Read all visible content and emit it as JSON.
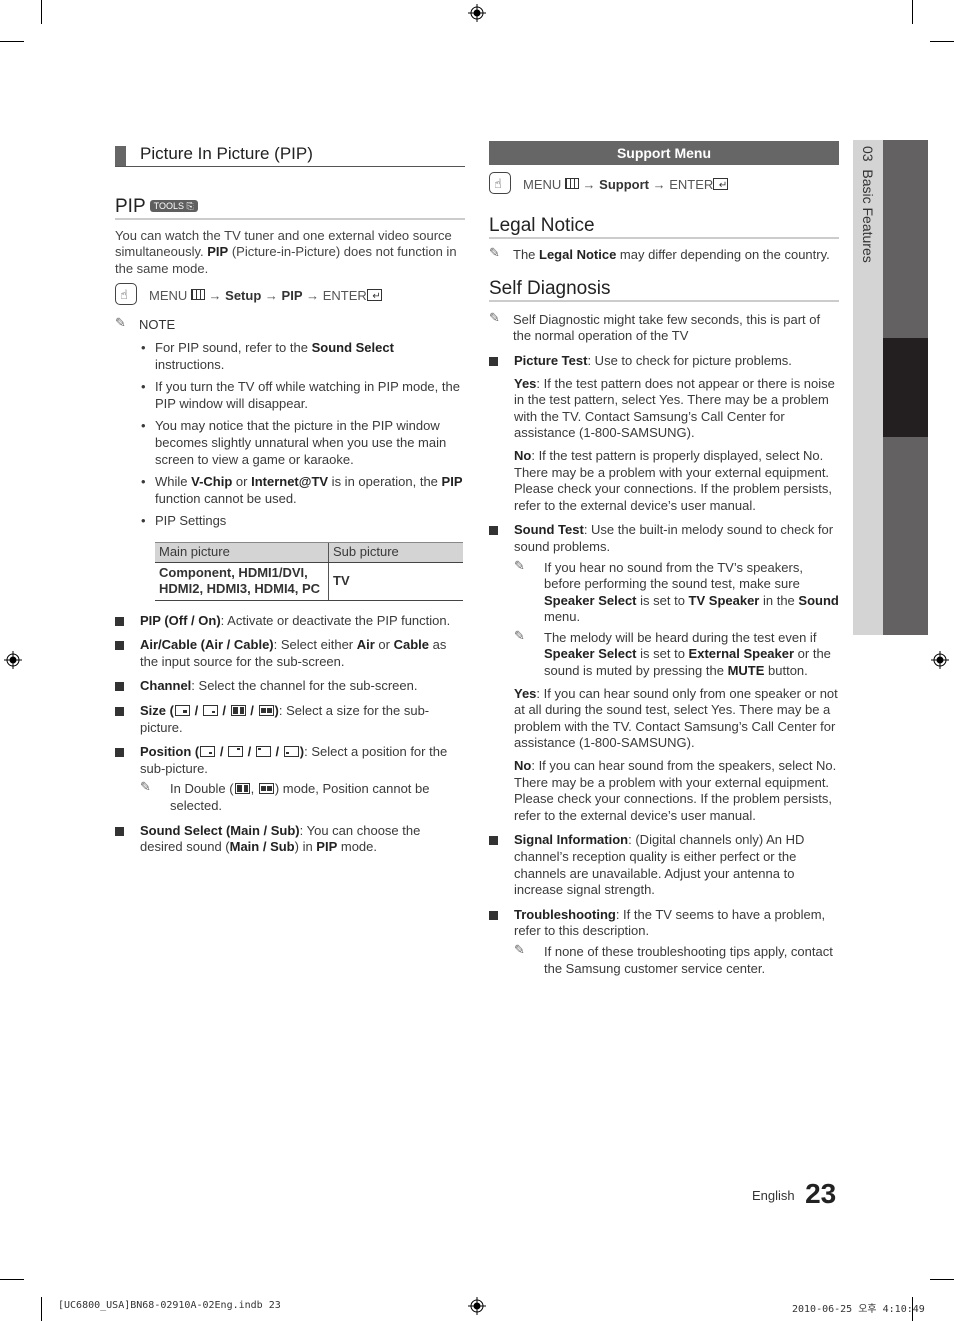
{
  "left": {
    "section_title": "Picture In Picture (PIP)",
    "pip_heading": "PIP",
    "tools_badge": "TOOLS",
    "intro": [
      {
        "t": "You can watch the TV tuner and one external video source simultaneously. "
      },
      {
        "t": "PIP",
        "b": true
      },
      {
        "t": " (Picture-in-Picture) does not function in the same mode."
      }
    ],
    "menu_path": {
      "menu": "MENU",
      "arrow1": "→",
      "step1": "Setup",
      "arrow2": "→",
      "step2": "PIP",
      "arrow3": "→",
      "enter": "ENTER"
    },
    "note_label": "NOTE",
    "notes": [
      [
        {
          "t": "For PIP sound, refer to the "
        },
        {
          "t": "Sound Select",
          "b": true
        },
        {
          "t": " instructions."
        }
      ],
      [
        {
          "t": "If you turn the TV off while watching in PIP mode, the PIP window will disappear."
        }
      ],
      [
        {
          "t": "You may notice that the picture in the PIP window becomes slightly unnatural when you use the main screen to view a game or karaoke."
        }
      ],
      [
        {
          "t": "While "
        },
        {
          "t": "V-Chip",
          "b": true
        },
        {
          "t": " or "
        },
        {
          "t": "Internet@TV",
          "b": true
        },
        {
          "t": " is in operation, the "
        },
        {
          "t": "PIP",
          "b": true
        },
        {
          "t": " function cannot be used."
        }
      ],
      [
        {
          "t": "PIP Settings"
        }
      ]
    ],
    "bullet_char": "•",
    "table": {
      "headers": [
        "Main picture",
        "Sub picture"
      ],
      "rows": [
        [
          "Component, HDMI1/DVI, HDMI2, HDMI3, HDMI4, PC",
          "TV"
        ]
      ]
    },
    "items": [
      {
        "parts": [
          {
            "t": "PIP (Off / On)",
            "b": true
          },
          {
            "t": ": Activate or deactivate the PIP function."
          }
        ]
      },
      {
        "parts": [
          {
            "t": "Air/Cable (Air / Cable)",
            "b": true
          },
          {
            "t": ": Select either "
          },
          {
            "t": "Air",
            "b": true
          },
          {
            "t": " or "
          },
          {
            "t": "Cable",
            "b": true
          },
          {
            "t": " as the input source for the sub-screen."
          }
        ]
      },
      {
        "parts": [
          {
            "t": "Channel",
            "b": true
          },
          {
            "t": ": Select the channel for the sub-screen."
          }
        ]
      },
      {
        "parts": [
          {
            "t": "Size (",
            "b": true
          },
          {
            "g": "size-small"
          },
          {
            "t": " / ",
            "b": true
          },
          {
            "g": "size-large"
          },
          {
            "t": " / ",
            "b": true
          },
          {
            "g": "double-vertical"
          },
          {
            "t": " / ",
            "b": true
          },
          {
            "g": "double-horizontal"
          },
          {
            "t": ")",
            "b": true
          },
          {
            "t": ": Select a size for the sub-picture."
          }
        ]
      },
      {
        "parts": [
          {
            "t": "Position (",
            "b": true
          },
          {
            "g": "pos-bottom-right"
          },
          {
            "t": " / ",
            "b": true
          },
          {
            "g": "pos-top-right"
          },
          {
            "t": " / ",
            "b": true
          },
          {
            "g": "pos-top-left"
          },
          {
            "t": " / ",
            "b": true
          },
          {
            "g": "pos-bottom-left"
          },
          {
            "t": ")",
            "b": true
          },
          {
            "t": ": Select a position for the sub-picture."
          }
        ],
        "subnotes": [
          [
            {
              "t": "In Double ("
            },
            {
              "g": "double-vertical"
            },
            {
              "t": ", "
            },
            {
              "g": "double-horizontal"
            },
            {
              "t": ") mode, Position cannot be selected."
            }
          ]
        ]
      },
      {
        "parts": [
          {
            "t": "Sound Select (Main / Sub)",
            "b": true
          },
          {
            "t": ": You can choose the desired sound ("
          },
          {
            "t": "Main / Sub",
            "b": true
          },
          {
            "t": ") in "
          },
          {
            "t": "PIP",
            "b": true
          },
          {
            "t": " mode."
          }
        ]
      }
    ]
  },
  "right": {
    "support_bar": "Support Menu",
    "menu_path": {
      "menu": "MENU",
      "arrow1": "→",
      "step1": "Support",
      "arrow2": "→",
      "enter": "ENTER"
    },
    "legal_heading": "Legal Notice",
    "legal_note": [
      {
        "t": "The "
      },
      {
        "t": "Legal Notice",
        "b": true
      },
      {
        "t": " may differ depending on the country."
      }
    ],
    "self_heading": "Self Diagnosis",
    "self_note": [
      {
        "t": "Self Diagnostic might take few seconds, this is part of the normal operation of the TV"
      }
    ],
    "items": [
      {
        "parts": [
          {
            "t": "Picture Test",
            "b": true
          },
          {
            "t": ": Use to check for picture problems."
          }
        ],
        "paras": [
          [
            {
              "t": "Yes",
              "b": true
            },
            {
              "t": ": If the test pattern does not appear or there is noise in the test pattern, select Yes. There may be a problem with the TV. Contact Samsung’s Call Center for assistance (1-800-SAMSUNG)."
            }
          ],
          [
            {
              "t": "No",
              "b": true
            },
            {
              "t": ": If the test pattern is properly displayed, select No. There may be a problem with your external equipment. Please check your connections. If the problem persists, refer to the external device’s user manual."
            }
          ]
        ]
      },
      {
        "parts": [
          {
            "t": "Sound Test",
            "b": true
          },
          {
            "t": ": Use the built-in melody sound to check for sound problems."
          }
        ],
        "subnotes": [
          [
            {
              "t": "If you hear no sound from the TV’s speakers, before performing the sound test, make sure "
            },
            {
              "t": "Speaker Select",
              "b": true
            },
            {
              "t": " is set to "
            },
            {
              "t": "TV Speaker",
              "b": true
            },
            {
              "t": " in the "
            },
            {
              "t": "Sound",
              "b": true
            },
            {
              "t": " menu."
            }
          ],
          [
            {
              "t": "The melody will be heard during the test even if "
            },
            {
              "t": "Speaker Select",
              "b": true
            },
            {
              "t": " is set to "
            },
            {
              "t": "External Speaker",
              "b": true
            },
            {
              "t": " or the sound is muted by pressing the "
            },
            {
              "t": "MUTE",
              "b": true
            },
            {
              "t": " button."
            }
          ]
        ],
        "paras": [
          [
            {
              "t": "Yes",
              "b": true
            },
            {
              "t": ": If you can hear sound only from one speaker or not at all during the sound test, select Yes. There may be a problem with the TV. Contact Samsung’s Call Center for assistance (1-800-SAMSUNG)."
            }
          ],
          [
            {
              "t": "No",
              "b": true
            },
            {
              "t": ": If you can hear sound from the speakers, select No. There may be a problem with your external equipment. Please check your connections. If the problem persists, refer to the external device’s user manual."
            }
          ]
        ]
      },
      {
        "parts": [
          {
            "t": "Signal Information",
            "b": true
          },
          {
            "t": ": (Digital channels only) An HD channel’s reception quality is either perfect or the channels are unavailable. Adjust your antenna to increase signal strength."
          }
        ]
      },
      {
        "parts": [
          {
            "t": "Troubleshooting",
            "b": true
          },
          {
            "t": ": If the TV seems to have a problem, refer to this description."
          }
        ],
        "subnotes": [
          [
            {
              "t": "If none of these troubleshooting tips apply, contact the Samsung customer service center."
            }
          ]
        ]
      }
    ]
  },
  "side_tab": {
    "chapter": "03",
    "label": "Basic Features"
  },
  "footer": {
    "language": "English",
    "page_number": "23",
    "file_info": "[UC6800_USA]BN68-02910A-02Eng.indb   23",
    "timestamp": "2010-06-25   오후 4:10:49"
  },
  "colors": {
    "bar_gray": "#666666",
    "side_light": "#d4d4d4",
    "side_dark": "#231f20",
    "side_mid": "#636161"
  }
}
